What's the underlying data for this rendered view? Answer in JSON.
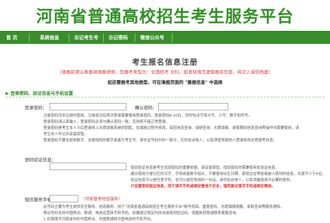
{
  "header": {
    "title": "河南省普通高校招生考生服务平台"
  },
  "nav": {
    "items": [
      "首  页",
      "系统信息",
      "忘记考生号",
      "忘记密码",
      "微信公众号"
    ]
  },
  "page": {
    "title": "考生报名信息注册",
    "notice_red": "（填报前请认真查阅填报说明，您报考类型为：全国统考 文科，如发现填写虚假报名信息，将记入诚信档案）",
    "notice_black": "如还需报考其他类型，可在填报页面的 \"兼报信息\" 中选择",
    "section_title": "▶ 登录密码、验证信息与手机设置"
  },
  "form": {
    "password_label": "登录密码：",
    "confirm_label": "确认密码：",
    "password_help": [
      "注册密码仅供注册时使用，注册成功后再次登录需要使用登录密码，登录密码6-20位，同时包含字母大写、小写、数字和符号。",
      "登录密码请认真输入，登录密码必须与确认密码一致，否则将不能正常登录。",
      "登录密码是考生本人今后登录网上志愿填报系统的钥匙，在填报过程中修改，高招信息查询、成绩查询、志愿填报、录取期间信息查询等操作均需要使用，请",
      "考生本人牢记并妥善保管。",
      "登录密码不要全部用数字、全部相同的数字或者为考生号、身份证号码中的一部分，切勿告诉他人，以免泄密导致他人登录修改志愿报考信息。"
    ],
    "verify_label": "密码验证信息：",
    "verify_help": [
      "密码验证信息是考生找回密码的重要依据，请妥善保管，找回密码时需要使用本验证信息。",
      "建议使用方便记忆的汉字、字母或者数字组合，不要使用出生日期、家庭住址等容易被人猜到的信息，长度不少于4位。",
      "验证信息可以是任意字符，也可以是您常用的一句话，请勿告诉他人，以免泄露造成不必要的损失。"
    ],
    "verify_warning": "只设置密码验证信息，而不填写手机或绑定微信不安全，强烈建议填写手机或绑定微信。",
    "phone_label": "短信服务手机：",
    "phone_hint": "（可能暂停短信服务）",
    "phone_help": [
      "此号码主要为考生提供安全服务、信息服务，用于\"河南省普通高校招生考生服务平台\"账号找回、重置密码、志愿填报提醒、录取查询等服务通知。",
      "移动号码支持中国移动、联通、电信运营商手机号码，如果超过规定时间未接收到验证码，请重新获取或联系客服咨询。",
      "1.仅限填写河南省内的中国移动、中国联通和中国电信的手机号码。"
    ]
  }
}
